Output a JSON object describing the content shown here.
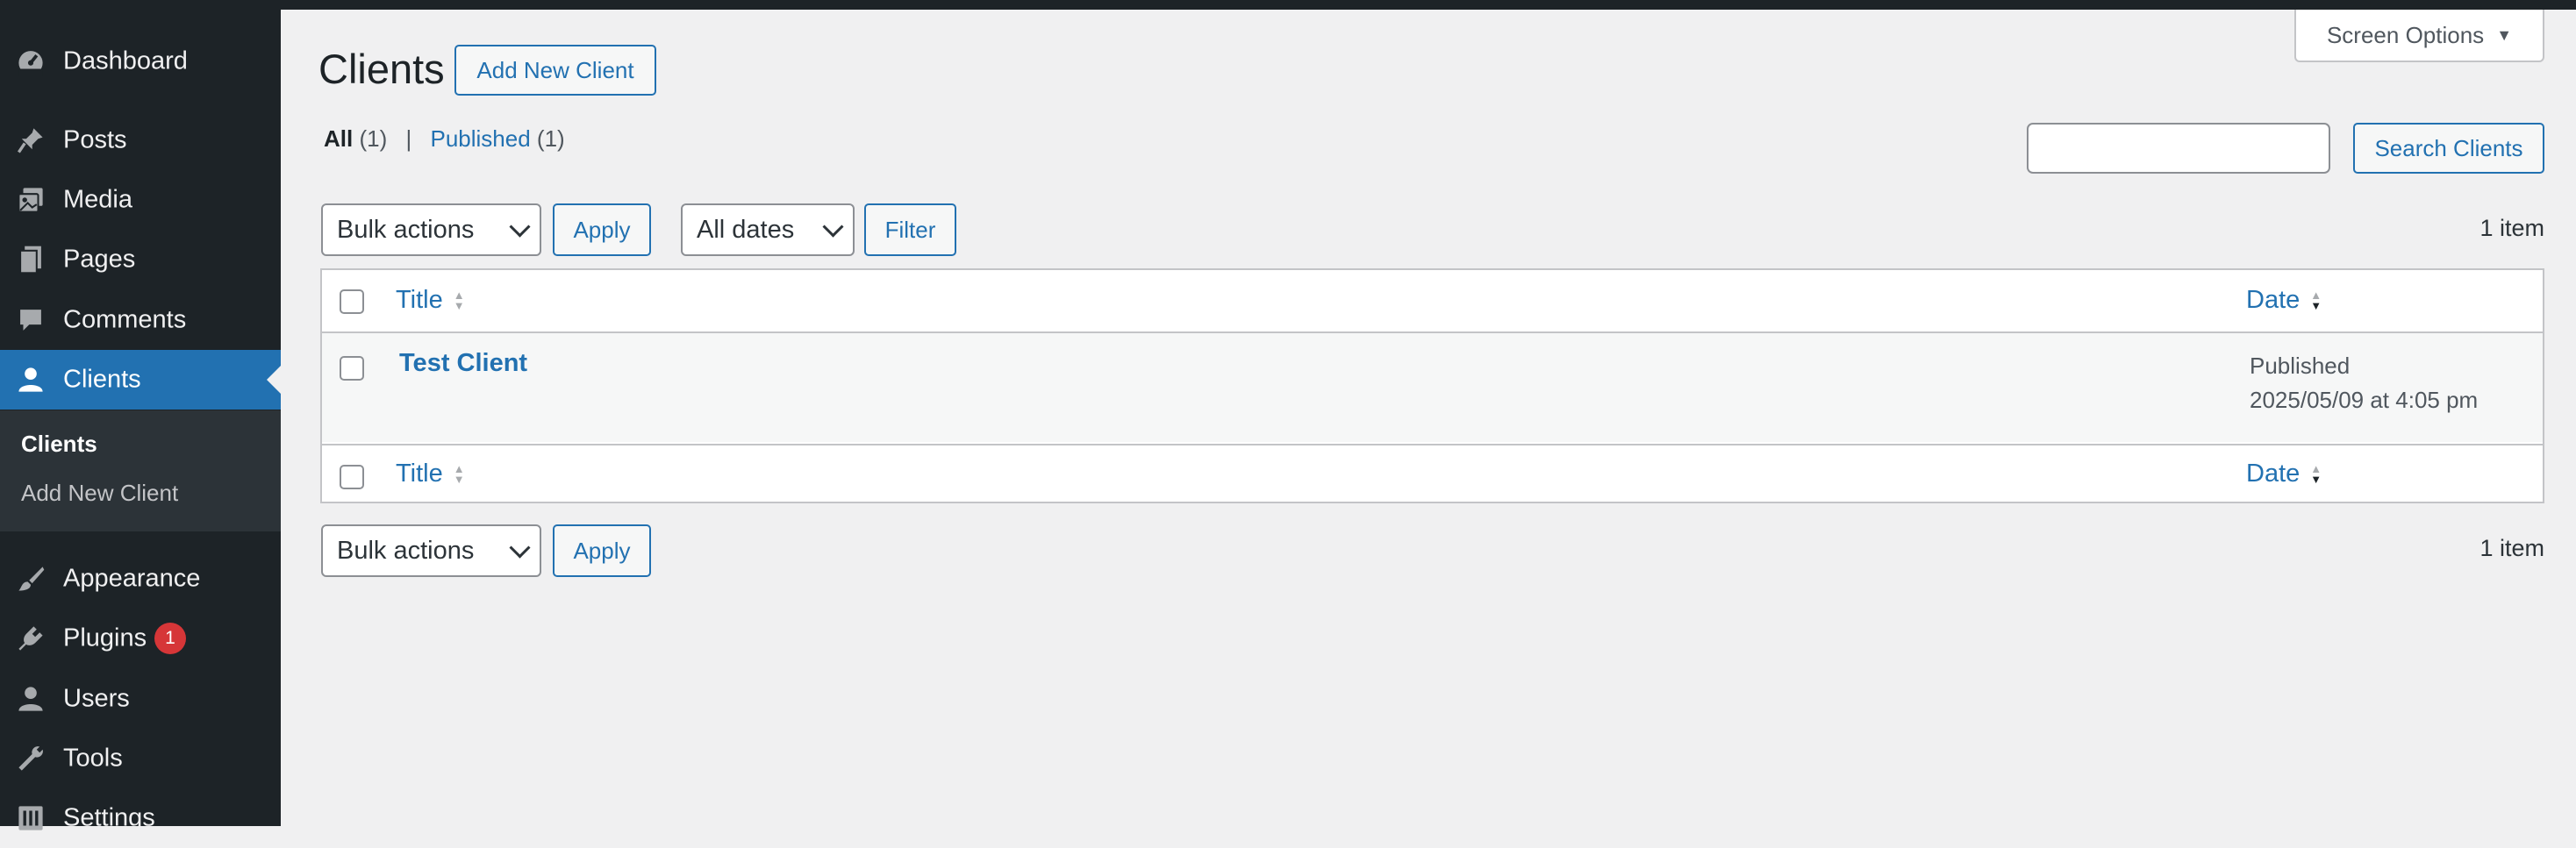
{
  "sidebar": {
    "items": [
      {
        "label": "Dashboard",
        "icon": "dashboard-icon"
      },
      {
        "label": "Posts",
        "icon": "pin-icon"
      },
      {
        "label": "Media",
        "icon": "media-icon"
      },
      {
        "label": "Pages",
        "icon": "pages-icon"
      },
      {
        "label": "Comments",
        "icon": "comment-icon"
      },
      {
        "label": "Clients",
        "icon": "user-icon",
        "current": true
      },
      {
        "label": "Appearance",
        "icon": "brush-icon"
      },
      {
        "label": "Plugins",
        "icon": "plugin-icon",
        "badge": "1"
      },
      {
        "label": "Users",
        "icon": "users-icon"
      },
      {
        "label": "Tools",
        "icon": "wrench-icon"
      },
      {
        "label": "Settings",
        "icon": "settings-icon"
      }
    ],
    "submenu": [
      "Clients",
      "Add New Client"
    ]
  },
  "header": {
    "title": "Clients",
    "add_new_label": "Add New Client",
    "screen_options_label": "Screen Options",
    "screen_options_arrow": "▼"
  },
  "filters": {
    "all_label": "All",
    "all_count": "(1)",
    "separator": "|",
    "published_label": "Published",
    "published_count": "(1)"
  },
  "search": {
    "value": "",
    "button_label": "Search Clients"
  },
  "tablenav": {
    "bulk_actions": "Bulk actions",
    "apply": "Apply",
    "all_dates": "All dates",
    "filter": "Filter",
    "items_count": "1 item"
  },
  "table": {
    "columns": {
      "title": "Title",
      "date": "Date"
    },
    "rows": [
      {
        "title": "Test Client",
        "status": "Published",
        "date": "2025/05/09 at 4:05 pm"
      }
    ]
  },
  "colors": {
    "sidebar_bg": "#1d2327",
    "accent": "#2271b1",
    "badge": "#d63638",
    "page_bg": "#f0f0f1"
  }
}
